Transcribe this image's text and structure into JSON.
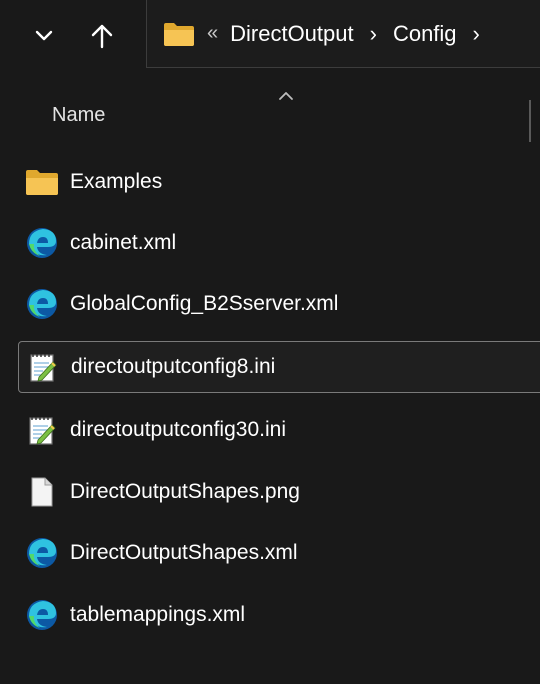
{
  "toolbar": {
    "expand_icon": "chevron-down-icon",
    "up_icon": "up-arrow-icon"
  },
  "address": {
    "folder_icon": "folder-icon",
    "overflow": "«",
    "crumbs": [
      "DirectOutput",
      "Config"
    ],
    "chevron": "›"
  },
  "column": {
    "name": "Name",
    "sort": "ascending"
  },
  "files": [
    {
      "name": "Examples",
      "icon": "folder-icon"
    },
    {
      "name": "cabinet.xml",
      "icon": "edge-icon"
    },
    {
      "name": "GlobalConfig_B2Sserver.xml",
      "icon": "edge-icon"
    },
    {
      "name": "directoutputconfig8.ini",
      "icon": "notepad-icon",
      "selected": true
    },
    {
      "name": "directoutputconfig30.ini",
      "icon": "notepad-icon"
    },
    {
      "name": "DirectOutputShapes.png",
      "icon": "blank-file-icon"
    },
    {
      "name": "DirectOutputShapes.xml",
      "icon": "edge-icon"
    },
    {
      "name": "tablemappings.xml",
      "icon": "edge-icon"
    }
  ],
  "colors": {
    "background": "#191919",
    "text": "#ffffff",
    "folder": "#f6c454",
    "selection_border": "#7a7a7a"
  }
}
